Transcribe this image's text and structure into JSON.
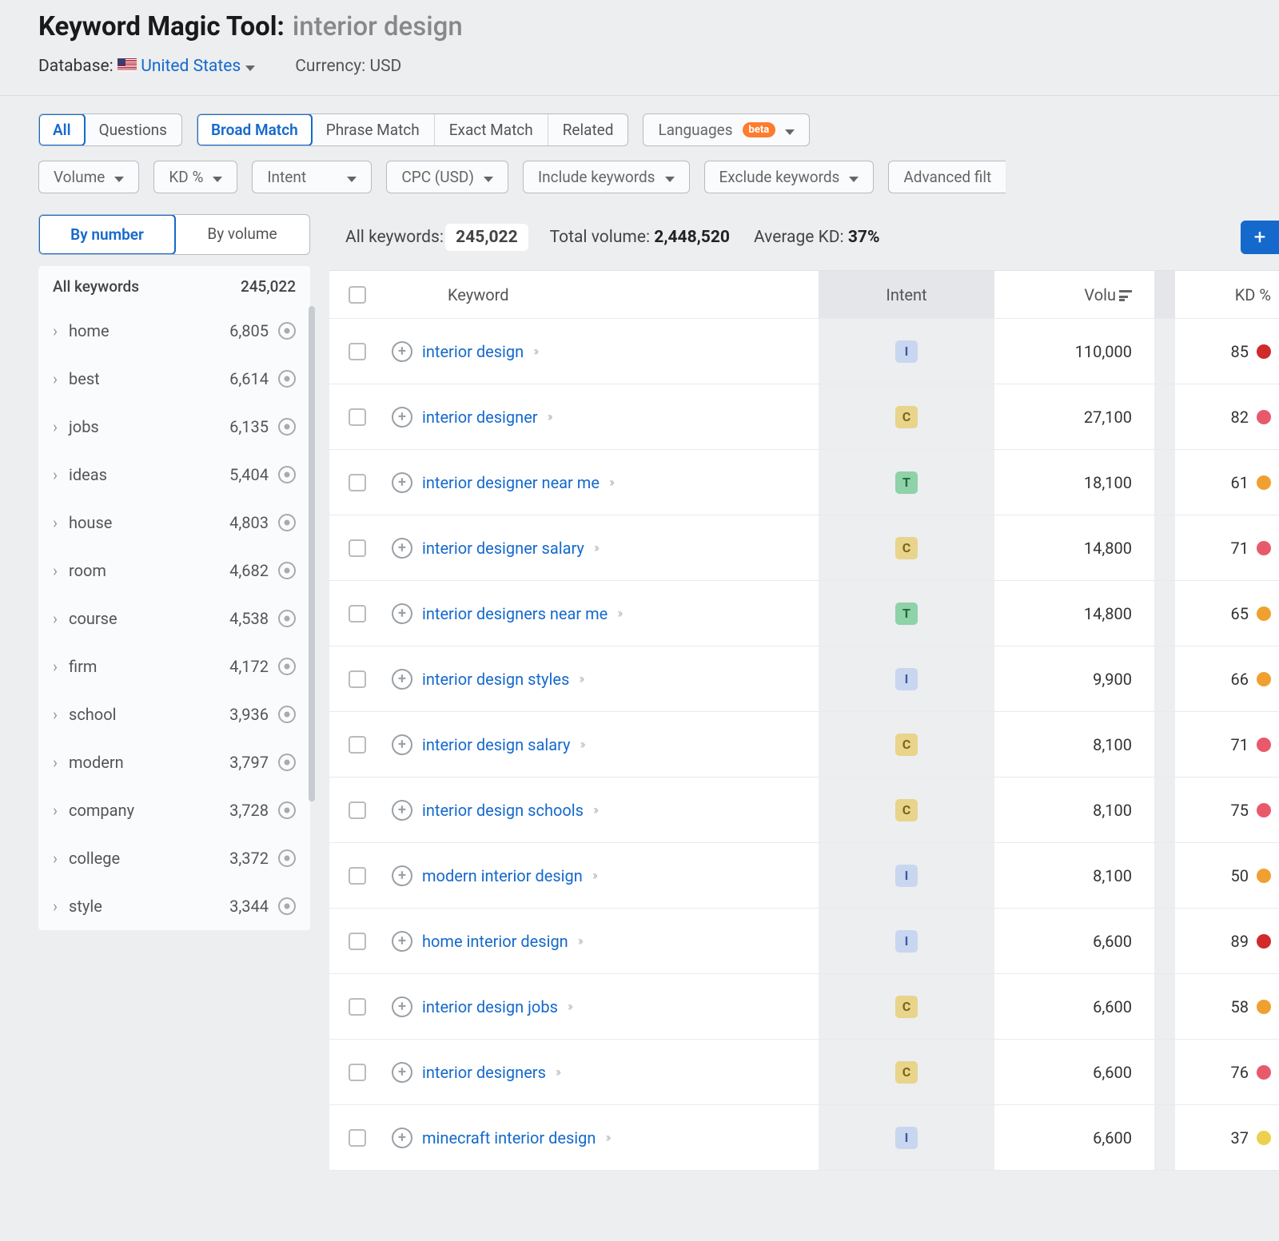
{
  "header": {
    "tool_name": "Keyword Magic Tool:",
    "query": "interior design",
    "database_label": "Database:",
    "database_value": "United States",
    "currency_label": "Currency:",
    "currency_value": "USD"
  },
  "mode_tabs": {
    "all": "All",
    "questions": "Questions"
  },
  "match_tabs": {
    "broad": "Broad Match",
    "phrase": "Phrase Match",
    "exact": "Exact Match",
    "related": "Related"
  },
  "languages_btn": {
    "label": "Languages",
    "badge": "beta"
  },
  "filters": {
    "volume": "Volume",
    "kd": "KD %",
    "intent": "Intent",
    "cpc": "CPC (USD)",
    "include": "Include keywords",
    "exclude": "Exclude keywords",
    "advanced": "Advanced filt"
  },
  "sidebar": {
    "by_number": "By number",
    "by_volume": "By volume",
    "head_label": "All keywords",
    "head_count": "245,022",
    "items": [
      {
        "label": "home",
        "count": "6,805"
      },
      {
        "label": "best",
        "count": "6,614"
      },
      {
        "label": "jobs",
        "count": "6,135"
      },
      {
        "label": "ideas",
        "count": "5,404"
      },
      {
        "label": "house",
        "count": "4,803"
      },
      {
        "label": "room",
        "count": "4,682"
      },
      {
        "label": "course",
        "count": "4,538"
      },
      {
        "label": "firm",
        "count": "4,172"
      },
      {
        "label": "school",
        "count": "3,936"
      },
      {
        "label": "modern",
        "count": "3,797"
      },
      {
        "label": "company",
        "count": "3,728"
      },
      {
        "label": "college",
        "count": "3,372"
      },
      {
        "label": "style",
        "count": "3,344"
      }
    ]
  },
  "stats": {
    "all_keywords_label": "All keywords:",
    "all_keywords_value": "245,022",
    "total_volume_label": "Total volume:",
    "total_volume_value": "2,448,520",
    "avg_kd_label": "Average KD:",
    "avg_kd_value": "37%"
  },
  "table": {
    "headers": {
      "keyword": "Keyword",
      "intent": "Intent",
      "volume": "Volu",
      "kd": "KD %"
    },
    "rows": [
      {
        "keyword": "interior design",
        "intent": "I",
        "volume": "110,000",
        "kd": "85",
        "kd_color": "red"
      },
      {
        "keyword": "interior designer",
        "intent": "C",
        "volume": "27,100",
        "kd": "82",
        "kd_color": "pink"
      },
      {
        "keyword": "interior designer near me",
        "intent": "T",
        "volume": "18,100",
        "kd": "61",
        "kd_color": "orange"
      },
      {
        "keyword": "interior designer salary",
        "intent": "C",
        "volume": "14,800",
        "kd": "71",
        "kd_color": "pink"
      },
      {
        "keyword": "interior designers near me",
        "intent": "T",
        "volume": "14,800",
        "kd": "65",
        "kd_color": "orange"
      },
      {
        "keyword": "interior design styles",
        "intent": "I",
        "volume": "9,900",
        "kd": "66",
        "kd_color": "orange"
      },
      {
        "keyword": "interior design salary",
        "intent": "C",
        "volume": "8,100",
        "kd": "71",
        "kd_color": "pink"
      },
      {
        "keyword": "interior design schools",
        "intent": "C",
        "volume": "8,100",
        "kd": "75",
        "kd_color": "pink"
      },
      {
        "keyword": "modern interior design",
        "intent": "I",
        "volume": "8,100",
        "kd": "50",
        "kd_color": "orange"
      },
      {
        "keyword": "home interior design",
        "intent": "I",
        "volume": "6,600",
        "kd": "89",
        "kd_color": "red"
      },
      {
        "keyword": "interior design jobs",
        "intent": "C",
        "volume": "6,600",
        "kd": "58",
        "kd_color": "orange"
      },
      {
        "keyword": "interior designers",
        "intent": "C",
        "volume": "6,600",
        "kd": "76",
        "kd_color": "pink"
      },
      {
        "keyword": "minecraft interior design",
        "intent": "I",
        "volume": "6,600",
        "kd": "37",
        "kd_color": "yellow"
      }
    ]
  }
}
